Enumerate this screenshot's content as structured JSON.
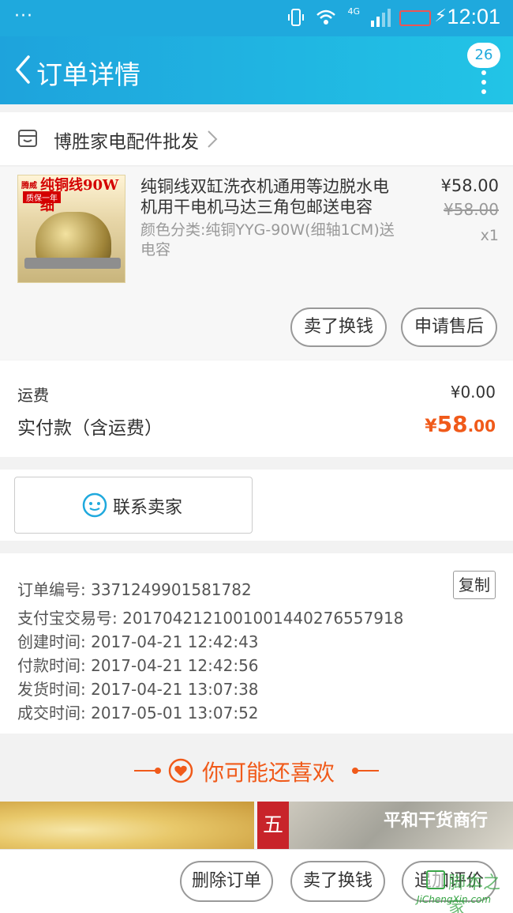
{
  "status_bar": {
    "dots": "···",
    "network": "4G",
    "time": "12:01"
  },
  "nav": {
    "title": "订单详情",
    "badge": "26"
  },
  "shop": {
    "name": "博胜家电配件批发"
  },
  "product": {
    "title": "纯铜线双缸洗衣机通用等边脱水电机用干电机马达三角包邮送电容",
    "sku": "颜色分类:纯铜YYG-90W(细轴1CM)送电容",
    "price": "¥58.00",
    "original_price": "¥58.00",
    "quantity": "x1",
    "image_text": {
      "brand": "腾威",
      "headline": "纯铜线90W细",
      "tag": "质保一年"
    },
    "actions": {
      "sell": "卖了换钱",
      "after_sale": "申请售后"
    }
  },
  "fees": {
    "shipping_label": "运费",
    "shipping_value": "¥0.00",
    "paid_label": "实付款（含运费）",
    "paid_currency": "¥",
    "paid_integer": "58",
    "paid_decimal": ".00"
  },
  "contact": {
    "label": "联系卖家"
  },
  "order_info": {
    "copy_label": "复制",
    "order_no_label": "订单编号:",
    "order_no": "3371249901581782",
    "alipay_label": "支付宝交易号:",
    "alipay_no": "2017042121001001440276557918",
    "created_label": "创建时间:",
    "created": "2017-04-21 12:42:43",
    "paid_label": "付款时间:",
    "paid": "2017-04-21 12:42:56",
    "shipped_label": "发货时间:",
    "shipped": "2017-04-21 13:07:38",
    "completed_label": "成交时间:",
    "completed": "2017-05-01 13:07:52"
  },
  "recommend": {
    "title": "你可能还喜欢",
    "item2_badge": "五",
    "item2_shop": "平和干货商行"
  },
  "bottom": {
    "delete": "删除订单",
    "sell": "卖了换钱",
    "review": "追加评价"
  },
  "watermark": {
    "text": "脚本之家",
    "url": "JiChengXin.com"
  },
  "colors": {
    "nav": "#1fa9dd",
    "accent": "#f05a1a"
  }
}
